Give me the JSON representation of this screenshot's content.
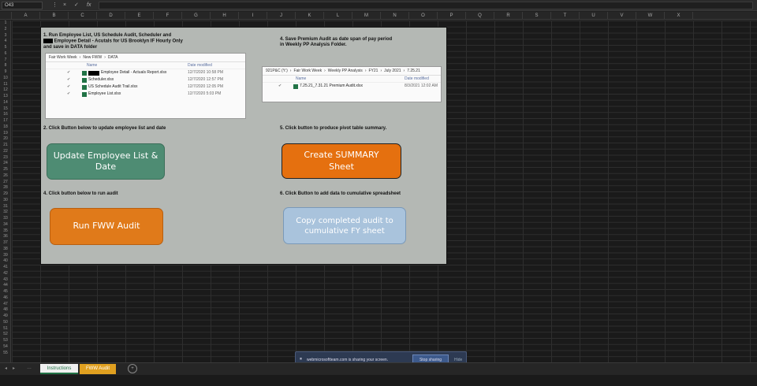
{
  "formula_bar": {
    "name_box": "O43",
    "cancel_icon": "×",
    "enter_icon": "✓",
    "fx_icon": "fx"
  },
  "columns": [
    "A",
    "B",
    "C",
    "D",
    "E",
    "F",
    "G",
    "H",
    "I",
    "J",
    "K",
    "L",
    "M",
    "N",
    "O",
    "P",
    "Q",
    "R",
    "S",
    "T",
    "U",
    "V",
    "W",
    "X"
  ],
  "rows": [
    "1",
    "2",
    "3",
    "4",
    "5",
    "6",
    "7",
    "8",
    "9",
    "10",
    "11",
    "12",
    "13",
    "14",
    "15",
    "16",
    "17",
    "18",
    "19",
    "20",
    "21",
    "22",
    "23",
    "24",
    "25",
    "26",
    "27",
    "28",
    "29",
    "30",
    "31",
    "32",
    "33",
    "34",
    "35",
    "36",
    "37",
    "38",
    "39",
    "40",
    "41",
    "42",
    "43",
    "44",
    "45",
    "46",
    "47",
    "48",
    "49",
    "50",
    "51",
    "52",
    "53",
    "54",
    "55"
  ],
  "step1": {
    "line1": "1. Run Employee List, US Schedule Audit, Scheduler and",
    "line2": "Employee Detail - Acutals for US Brooklyn IF Hourly Only",
    "line3": "and save in DATA folder"
  },
  "explorer1": {
    "crumbs": [
      "Fair Work Week",
      "›",
      "New FWW",
      "›",
      "DATA"
    ],
    "col_name": "Name",
    "col_date": "Date modified",
    "files": [
      {
        "name": "Employee Detail - Actuals Report.xlsx",
        "date": "12/7/2020 10:58 PM"
      },
      {
        "name": "Scheduler.xlsx",
        "date": "12/7/2020 12:57 PM"
      },
      {
        "name": "US Schedule Audit Trail.xlsx",
        "date": "12/7/2020 12:05 PM"
      },
      {
        "name": "Employee List.xlsx",
        "date": "12/7/2020 5:03 PM"
      }
    ]
  },
  "step2": "2. Click Button below to update employee list and date",
  "step3": "4. Click button below to run audit",
  "step4": {
    "line1": "4. Save Premium Audit as date span of pay period",
    "line2": "in Weekly PP Analysis Folder."
  },
  "explorer2": {
    "crumbs": [
      "921P&C (Y:)",
      "›",
      "Fair Work Week",
      "›",
      "Weekly PP Analysis",
      "›",
      "FY21",
      "›",
      "July 2021",
      "›",
      "7.25.21"
    ],
    "col_name": "Name",
    "col_date": "Date modified",
    "files": [
      {
        "name": "7.25.21_7.31.21 Premium Audit.xlsx",
        "date": "8/3/2021 12:02 AM"
      }
    ]
  },
  "step5": "5. Click button to produce pivot table summary.",
  "step6": "6. Click Button to add data to cumulative spreadsheet",
  "buttons": {
    "update": "Update Employee List & Date",
    "run": "Run FWW Audit",
    "summary": "Create SUMMARY Sheet",
    "copy": "Copy completed audit to cumulative FY sheet"
  },
  "colors": {
    "update": "#4e8c73",
    "run": "#e07a1a",
    "summary": "#e5700f",
    "copy": "#a9c3dc"
  },
  "tabs": {
    "active": "Instructions",
    "other": "FWW Audit",
    "add_icon": "+"
  },
  "share": {
    "text": "webmicrosoftteam.com is sharing your screen.",
    "stop": "Stop sharing",
    "hide": "Hide"
  }
}
